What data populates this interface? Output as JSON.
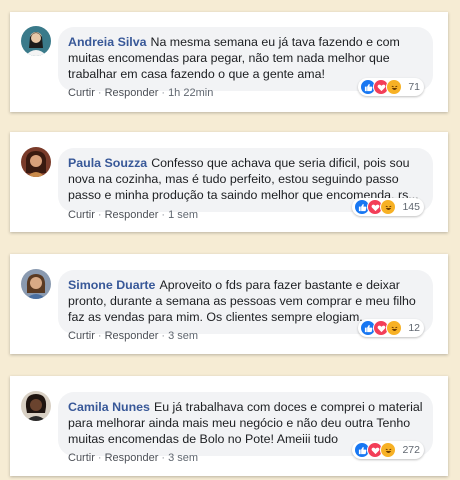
{
  "comments": [
    {
      "author": "Andreia Silva",
      "text": "Na mesma semana eu já tava fazendo e com muitas encomendas para pegar, não tem nada melhor que trabalhar em casa fazendo o que a gente ama!",
      "like": "Curtir",
      "reply": "Responder",
      "time": "1h 22min",
      "reactions_count": "71",
      "avatar_color": "#3a7a8a"
    },
    {
      "author": "Paula Souzza",
      "text": "Confesso que achava que seria dificil, pois sou nova na cozinha, mas é tudo perfeito, estou seguindo passo passo e minha produção ta saindo melhor que encomenda, rs...",
      "like": "Curtir",
      "reply": "Responder",
      "time": "1 sem",
      "reactions_count": "145",
      "avatar_color": "#7a3b2a"
    },
    {
      "author": "Simone Duarte",
      "text": "Aproveito o fds para fazer bastante e deixar pronto, durante a semana as pessoas vem comprar e meu filho faz as vendas para mim. Os clientes sempre elogiam...",
      "like": "Curtir",
      "reply": "Responder",
      "time": "3 sem",
      "reactions_count": "12",
      "avatar_color": "#8a9ab0"
    },
    {
      "author": "Camila Nunes",
      "text": "Eu já trabalhava com doces e comprei o material para melhorar ainda mais meu negócio e não deu outra Tenho muitas encomendas de Bolo no Pote! Ameiii tudo",
      "like": "Curtir",
      "reply": "Responder",
      "time": "3 sem",
      "reactions_count": "272",
      "avatar_color": "#4a3128"
    }
  ],
  "colors": {
    "background": "#f6ecd4",
    "author_link": "#385898",
    "like_blue": "#1877f2",
    "love_red": "#f33e58",
    "haha_yellow": "#f7b125"
  }
}
